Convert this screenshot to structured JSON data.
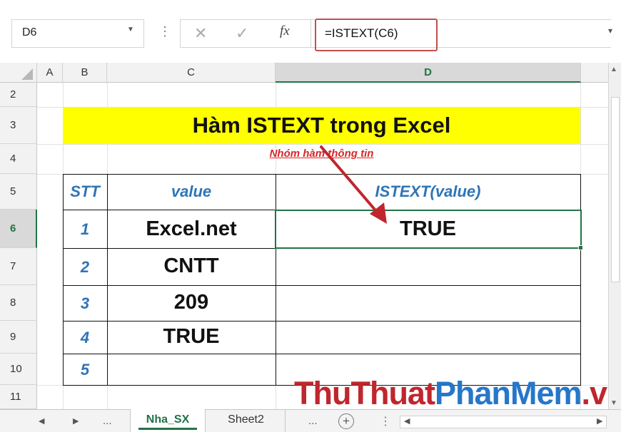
{
  "formula_bar": {
    "name_box": "D6",
    "formula": "=ISTEXT(C6)",
    "fx_label": "fx"
  },
  "columns": [
    "A",
    "B",
    "C",
    "D"
  ],
  "rows": [
    "2",
    "3",
    "4",
    "5",
    "6",
    "7",
    "8",
    "9",
    "10",
    "11"
  ],
  "sheet": {
    "title": "Hàm ISTEXT trong Excel",
    "subtitle": "Nhóm hàm thông tin",
    "headers": {
      "stt": "STT",
      "value": "value",
      "result": "ISTEXT(value)"
    },
    "table": [
      {
        "stt": "1",
        "value": "Excel.net",
        "result": "TRUE"
      },
      {
        "stt": "2",
        "value": "CNTT",
        "result": ""
      },
      {
        "stt": "3",
        "value": "209",
        "result": ""
      },
      {
        "stt": "4",
        "value": "TRUE",
        "result": ""
      },
      {
        "stt": "5",
        "value": "",
        "result": ""
      }
    ]
  },
  "tabs": {
    "more_left": "...",
    "active": "Nha_SX",
    "second": "Sheet2",
    "more_right": "..."
  },
  "watermark": {
    "part1": "ThuThuat",
    "part2": "PhanMem",
    "part3": ".vn"
  },
  "colors": {
    "accent": "#217346",
    "title_bg": "#ffff00",
    "header_text": "#2e75b6",
    "subtitle_text": "#d42828",
    "highlight_border": "#c0504d",
    "arrow": "#c0262d"
  },
  "icons": [
    "cancel-icon",
    "enter-icon",
    "fx-icon",
    "chevron-down-icon",
    "add-sheet-icon"
  ]
}
